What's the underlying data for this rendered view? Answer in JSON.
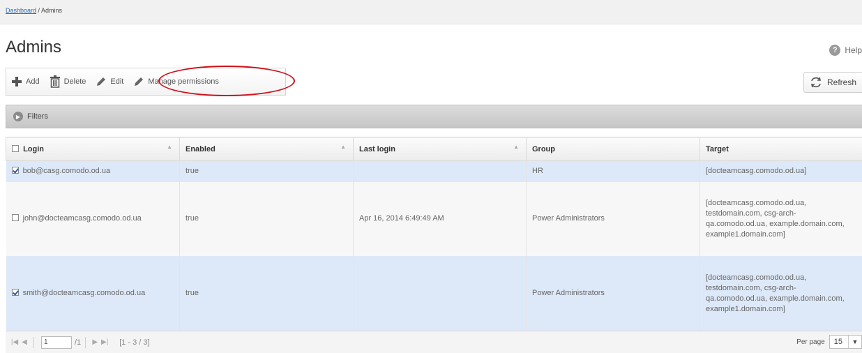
{
  "breadcrumb": {
    "link": "Dashboard",
    "separator": " / ",
    "current": "Admins"
  },
  "page_title": "Admins",
  "help_label": "Help",
  "toolbar": {
    "add_label": "Add",
    "delete_label": "Delete",
    "edit_label": "Edit",
    "manage_permissions_label": "Manage permissions"
  },
  "refresh_label": "Refresh",
  "filters_label": "Filters",
  "table": {
    "columns": [
      "Login",
      "Enabled",
      "Last login",
      "Group",
      "Target"
    ],
    "rows": [
      {
        "checked": true,
        "login": "bob@casg.comodo.od.ua",
        "enabled": "true",
        "last_login": "",
        "group": "HR",
        "target": "[docteamcasg.comodo.od.ua]"
      },
      {
        "checked": false,
        "login": "john@docteamcasg.comodo.od.ua",
        "enabled": "true",
        "last_login": "Apr 16, 2014 6:49:49 AM",
        "group": "Power Administrators",
        "target": "[docteamcasg.comodo.od.ua, testdomain.com, csg-arch-qa.comodo.od.ua, example.domain.com, example1.domain.com]"
      },
      {
        "checked": true,
        "login": "smith@docteamcasg.comodo.od.ua",
        "enabled": "true",
        "last_login": "",
        "group": "Power Administrators",
        "target": "[docteamcasg.comodo.od.ua, testdomain.com, csg-arch-qa.comodo.od.ua, example.domain.com, example1.domain.com]"
      }
    ]
  },
  "pager": {
    "page": "1",
    "total_pages": "/1",
    "range": "[1 - 3 / 3]",
    "per_page_label": "Per page",
    "per_page_value": "15"
  },
  "colors": {
    "selected_row": "#dde9f8",
    "annotation": "#d0121b",
    "link": "#2a6bb8"
  },
  "icons": [
    "plus-icon",
    "trash-icon",
    "pencil-icon",
    "help-icon",
    "refresh-icon",
    "chevron-right-icon",
    "first-page-icon",
    "prev-page-icon",
    "next-page-icon",
    "last-page-icon",
    "chevron-down-icon"
  ]
}
